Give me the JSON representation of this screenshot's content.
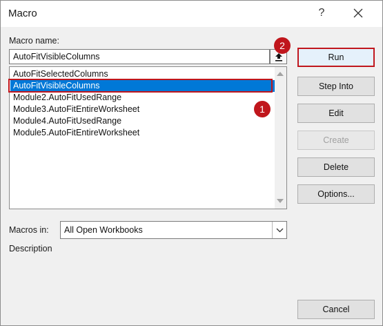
{
  "window": {
    "title": "Macro",
    "help_label": "?"
  },
  "macro_name": {
    "label": "Macro name:",
    "value": "AutoFitVisibleColumns"
  },
  "macro_list": {
    "items": [
      "AutoFitSelectedColumns",
      "AutoFitVisibleColumns",
      "Module2.AutoFitUsedRange",
      "Module3.AutoFitEntireWorksheet",
      "Module4.AutoFitUsedRange",
      "Module5.AutoFitEntireWorksheet"
    ],
    "selected_index": 1
  },
  "annotations": {
    "step1": "1",
    "step2": "2",
    "color": "#c0161c"
  },
  "buttons": {
    "run": "Run",
    "step_into": "Step Into",
    "edit": "Edit",
    "create": "Create",
    "delete": "Delete",
    "options": "Options...",
    "cancel": "Cancel"
  },
  "macros_in": {
    "label": "Macros in:",
    "value": "All Open Workbooks"
  },
  "description": {
    "label": "Description",
    "text": ""
  },
  "colors": {
    "selection": "#0078d7",
    "highlight": "#c0161c"
  }
}
